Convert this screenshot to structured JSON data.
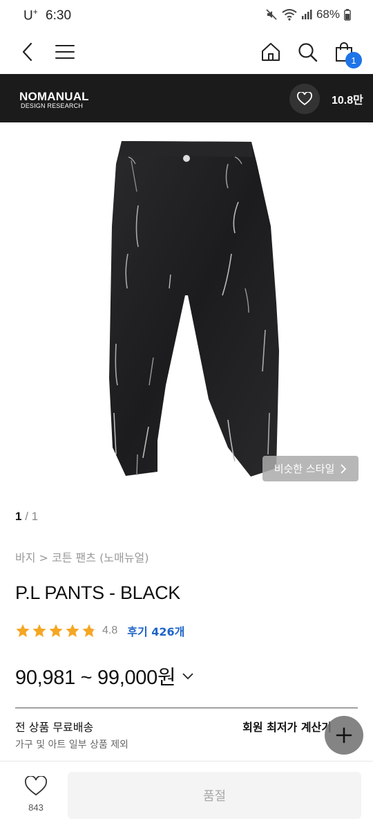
{
  "status_bar": {
    "carrier": "U",
    "carrier_sup": "+",
    "time": "6:30",
    "battery": "68%"
  },
  "nav": {
    "cart_count": "1"
  },
  "brand": {
    "name": "NOMANUAL",
    "sub": "DESIGN RESEARCH",
    "likes": "10.8만"
  },
  "product": {
    "similar_style_label": "비슷한 스타일",
    "image_index": "1",
    "image_total": "/ 1",
    "breadcrumb": "바지 > 코튼 팬츠 (노매뉴얼)",
    "title": "P.L PANTS - BLACK",
    "rating": "4.8",
    "rating_stars": 4.8,
    "review_label": "후기 426개",
    "price": "90,981 ~ 99,000원"
  },
  "shipping": {
    "title": "전 상품 무료배송",
    "sub": "가구 및 아트 일부 상품 제외",
    "calc_label": "회원 최저가 계산기"
  },
  "bottom_bar": {
    "wish_count": "843",
    "soldout_label": "품절"
  },
  "colors": {
    "accent_blue": "#1e74e8",
    "link_blue": "#1e64c8",
    "star": "#f5a623",
    "brand_bar": "#1b1b1b"
  },
  "icons": [
    "back-icon",
    "menu-icon",
    "home-icon",
    "search-icon",
    "cart-icon",
    "heart-icon",
    "chevron-right-icon",
    "chevron-down-icon",
    "plus-icon",
    "star-icon"
  ]
}
